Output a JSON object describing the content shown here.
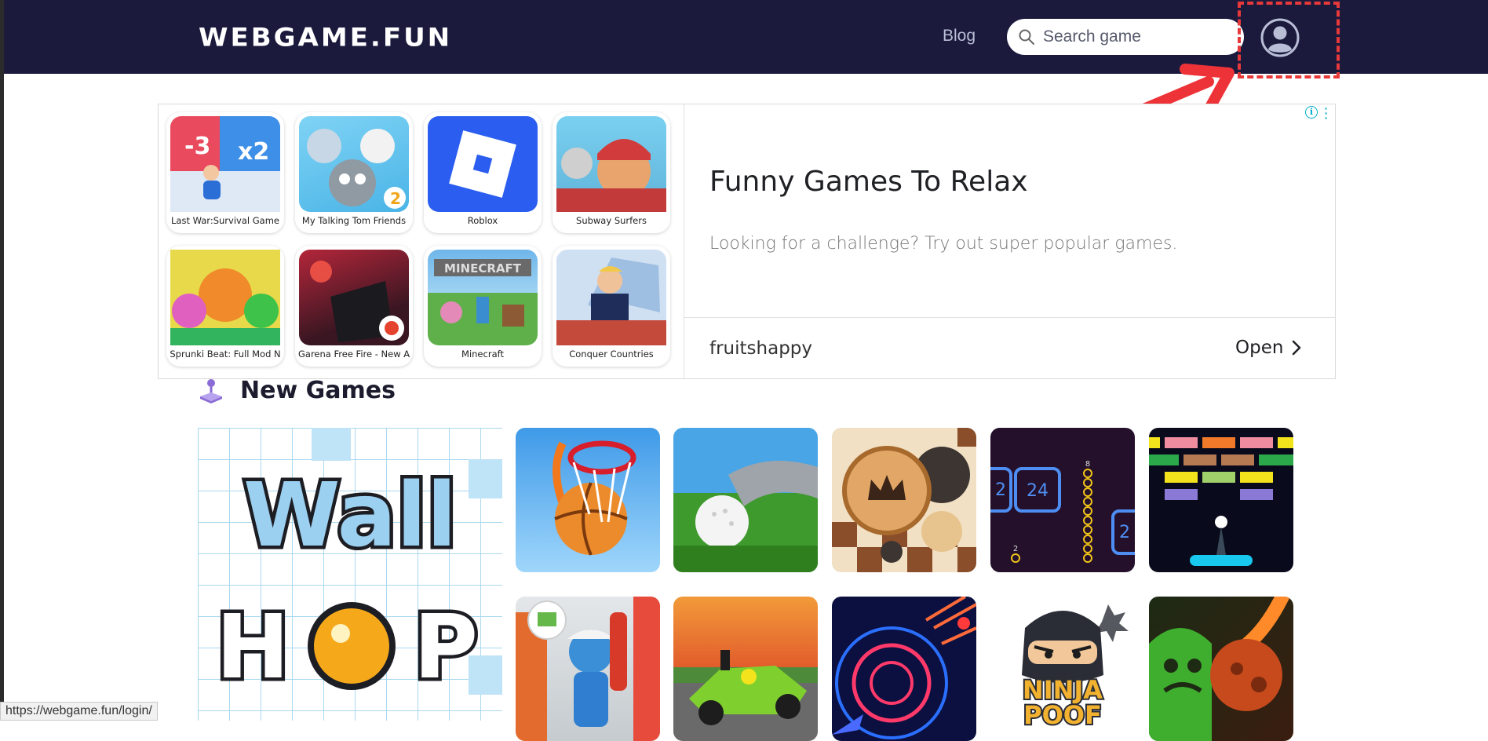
{
  "header": {
    "logo": "WEBGAME.FUN",
    "nav_blog": "Blog",
    "search_placeholder": "Search game"
  },
  "ad": {
    "apps": [
      {
        "label": "Last War:Survival Game"
      },
      {
        "label": "My Talking Tom Friends"
      },
      {
        "label": "Roblox"
      },
      {
        "label": "Subway Surfers"
      },
      {
        "label": "Sprunki Beat: Full Mod N"
      },
      {
        "label": "Garena Free Fire - New A"
      },
      {
        "label": "Minecraft"
      },
      {
        "label": "Conquer Countries"
      }
    ],
    "title": "Funny Games To Relax",
    "description": "Looking for a challenge? Try out super popular games.",
    "advertiser": "fruitshappy",
    "open_label": "Open"
  },
  "section": {
    "title": "New Games",
    "featured_text_line1": "Wall",
    "featured_text_line2": "H",
    "featured_text_line2b": "P",
    "ninja_text": "NINJA",
    "ninja_text2": "POOF",
    "number_tile_a": "24",
    "number_tile_b": "2",
    "number_tile_c": "8",
    "number_tile_d": "2",
    "number_tile_e": "2"
  },
  "status_bar": {
    "url": "https://webgame.fun/login/"
  },
  "colors": {
    "header_bg": "#1b1a3d",
    "highlight": "#e8393a",
    "ad_accent": "#00aecd"
  }
}
